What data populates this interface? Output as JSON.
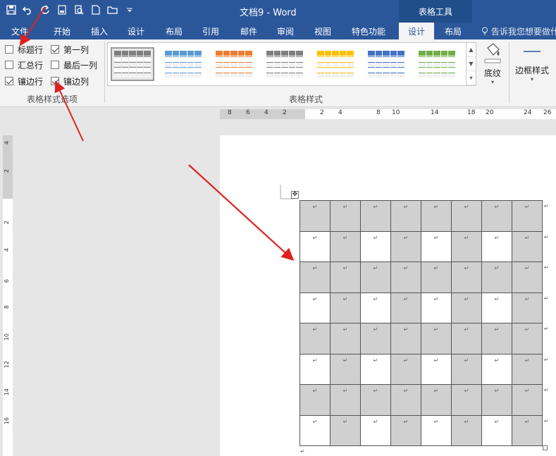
{
  "window": {
    "title": "文档9 - Word",
    "contextual_header": "表格工具"
  },
  "quick_access": {
    "icons": [
      "save-icon",
      "undo-icon",
      "redo-icon",
      "print-preview-icon",
      "preview-icon",
      "new-doc-icon",
      "open-folder-icon",
      "customize-icon"
    ]
  },
  "tabs": [
    {
      "label": "文件"
    },
    {
      "label": "开始"
    },
    {
      "label": "插入"
    },
    {
      "label": "设计"
    },
    {
      "label": "布局"
    },
    {
      "label": "引用"
    },
    {
      "label": "邮件"
    },
    {
      "label": "审阅"
    },
    {
      "label": "视图"
    },
    {
      "label": "特色功能"
    },
    {
      "label": "设计",
      "active": true
    },
    {
      "label": "布局"
    }
  ],
  "tell_me": "告诉我您想要做什么",
  "style_options": {
    "group_label": "表格样式选项",
    "items": [
      {
        "label": "标题行",
        "checked": false
      },
      {
        "label": "第一列",
        "checked": true
      },
      {
        "label": "汇总行",
        "checked": false
      },
      {
        "label": "最后一列",
        "checked": false
      },
      {
        "label": "镶边行",
        "checked": true
      },
      {
        "label": "镶边列",
        "checked": true
      }
    ]
  },
  "table_styles": {
    "group_label": "表格样式",
    "thumb_colors": [
      "#7f7f7f",
      "#5b9bd5",
      "#ed7d31",
      "#7f7f7f",
      "#ffc000",
      "#4472c4",
      "#70ad47"
    ],
    "selected_index": 0
  },
  "shading": {
    "label": "底纹"
  },
  "borders": {
    "label": "边框样式"
  },
  "ruler": {
    "h_ticks": [
      "8",
      "6",
      "4",
      "2",
      "2",
      "4",
      "8",
      "10",
      "14",
      "18",
      "20",
      "24",
      "26"
    ],
    "v_ticks": [
      "4",
      "2",
      "2",
      "4",
      "6",
      "8",
      "10",
      "12",
      "14",
      "16"
    ]
  },
  "document_table": {
    "rows": 8,
    "cols": 8,
    "cell_mark": "↵",
    "banding": "banded-rows-and-columns"
  },
  "colors": {
    "accent": "#2b579a",
    "shade": "#d0d0d0",
    "annotation_arrow": "#e02020"
  }
}
